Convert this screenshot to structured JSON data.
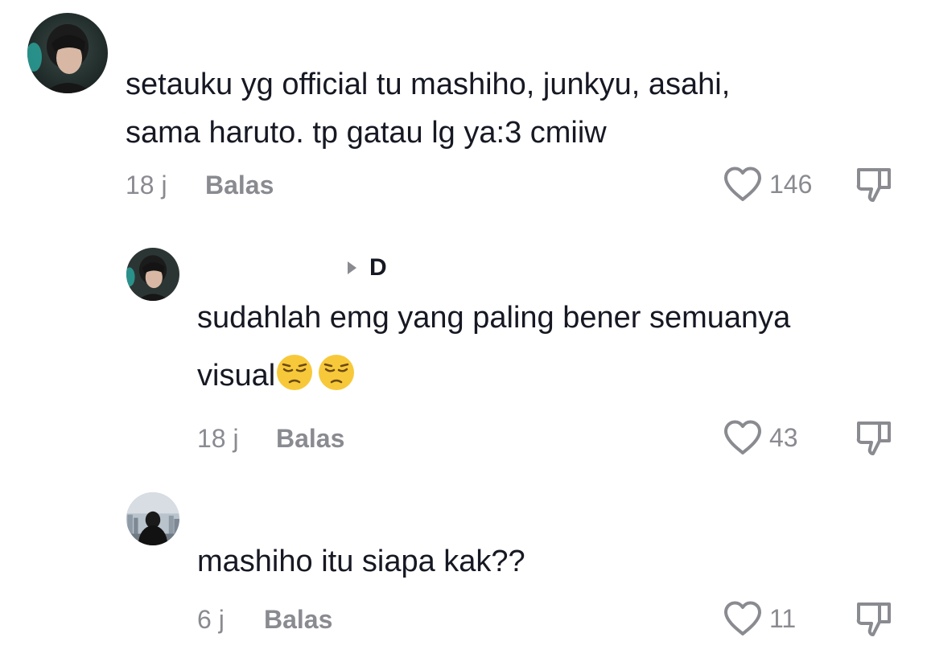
{
  "comments": [
    {
      "avatar_icon": "user-avatar-photo",
      "text_lines": [
        "setauku yg official tu mashiho, junkyu, asahi,",
        "sama haruto. tp gatau lg ya:3 cmiiw"
      ],
      "time": "18 j",
      "reply_label": "Balas",
      "likes": "146"
    },
    {
      "avatar_icon": "user-avatar-photo",
      "reply_to": "D",
      "text_lines": [
        "sudahlah emg yang paling bener semuanya",
        "visual"
      ],
      "emojis": [
        "pensive-face-emoji",
        "pensive-face-emoji"
      ],
      "time": "18 j",
      "reply_label": "Balas",
      "likes": "43"
    },
    {
      "avatar_icon": "user-avatar-photo-city",
      "text_lines": [
        "mashiho itu siapa kak??"
      ],
      "time": "6 j",
      "reply_label": "Balas",
      "likes": "11"
    }
  ],
  "colors": {
    "text": "#161823",
    "muted": "#8a8b91"
  }
}
